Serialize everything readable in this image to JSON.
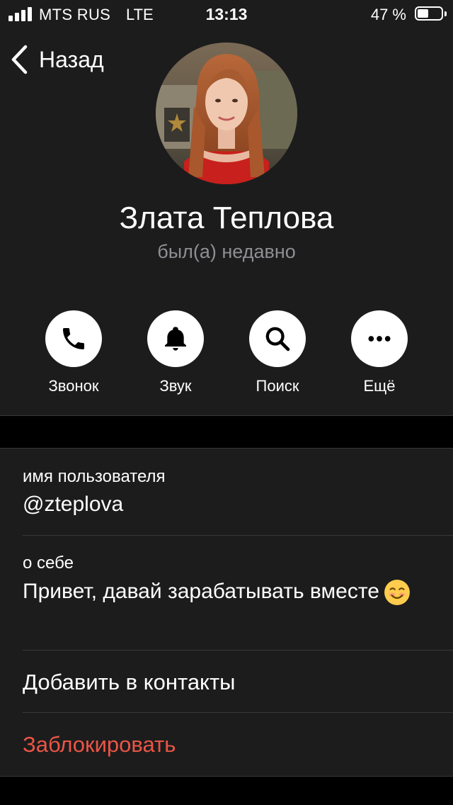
{
  "status_bar": {
    "carrier": "MTS RUS",
    "network": "LTE",
    "time": "13:13",
    "battery_percent": "47 %",
    "battery_level": 0.47
  },
  "nav": {
    "back_label": "Назад"
  },
  "profile": {
    "name": "Злата Теплова",
    "last_seen": "был(а) недавно"
  },
  "actions": [
    {
      "label": "Звонок",
      "icon": "phone-icon"
    },
    {
      "label": "Звук",
      "icon": "bell-icon"
    },
    {
      "label": "Поиск",
      "icon": "search-icon"
    },
    {
      "label": "Ещё",
      "icon": "more-icon"
    }
  ],
  "info": {
    "username_title": "имя пользователя",
    "username_value": "@zteplova",
    "about_title": "о себе",
    "about_value": "Привет, давай зарабатывать вместе",
    "about_emoji": "smiling-face-emoji"
  },
  "rows": {
    "add_contact": "Добавить в контакты",
    "block": "Заблокировать"
  },
  "colors": {
    "background": "#000000",
    "panel": "#1c1c1d",
    "secondary_text": "#8e8e93",
    "destructive": "#eb5545",
    "separator": "#38383a"
  }
}
